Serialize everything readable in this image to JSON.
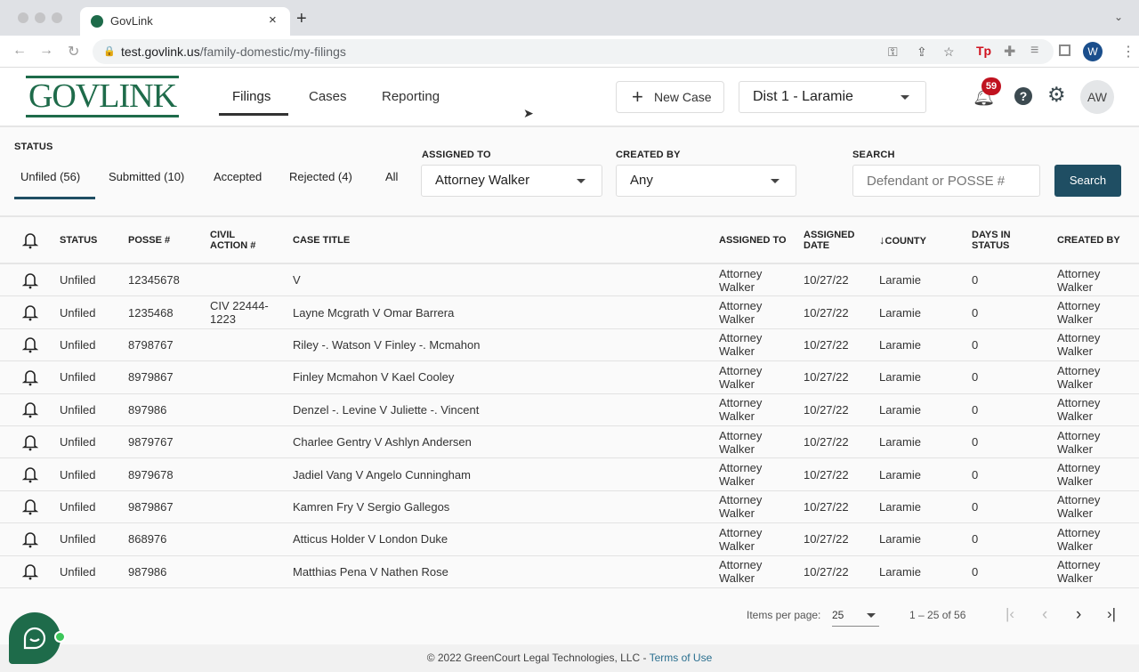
{
  "browser": {
    "tab_title": "GovLink",
    "url_host": "test.govlink.us",
    "url_path": "/family-domestic/my-filings",
    "profile_initial": "W",
    "ext_label": "Tp"
  },
  "header": {
    "logo": "GOVLINK",
    "nav": [
      {
        "label": "Filings",
        "active": true
      },
      {
        "label": "Cases"
      },
      {
        "label": "Reporting"
      }
    ],
    "new_case": "New Case",
    "district": "Dist 1 - Laramie",
    "notif_count": "59",
    "avatar": "AW"
  },
  "filters": {
    "status_label": "STATUS",
    "tabs": [
      "Unfiled (56)",
      "Submitted (10)",
      "Accepted",
      "Rejected (4)",
      "All"
    ],
    "active_tab": 0,
    "assigned_label": "ASSIGNED TO",
    "assigned_value": "Attorney Walker",
    "created_label": "CREATED BY",
    "created_value": "Any",
    "search_label": "SEARCH",
    "search_placeholder": "Defendant or POSSE #",
    "search_button": "Search"
  },
  "table": {
    "headers": [
      "STATUS",
      "POSSE #",
      "CIVIL ACTION #",
      "CASE TITLE",
      "ASSIGNED TO",
      "ASSIGNED DATE",
      "COUNTY",
      "DAYS IN STATUS",
      "CREATED BY"
    ],
    "sort_column": "COUNTY",
    "sort_direction": "desc",
    "rows": [
      [
        "Unfiled",
        "12345678",
        "",
        "V",
        "Attorney Walker",
        "10/27/22",
        "Laramie",
        "0",
        "Attorney Walker"
      ],
      [
        "Unfiled",
        "1235468",
        "CIV 22444-1223",
        "Layne Mcgrath V Omar Barrera",
        "Attorney Walker",
        "10/27/22",
        "Laramie",
        "0",
        "Attorney Walker"
      ],
      [
        "Unfiled",
        "8798767",
        "",
        "Riley -. Watson V Finley -. Mcmahon",
        "Attorney Walker",
        "10/27/22",
        "Laramie",
        "0",
        "Attorney Walker"
      ],
      [
        "Unfiled",
        "8979867",
        "",
        "Finley Mcmahon V Kael Cooley",
        "Attorney Walker",
        "10/27/22",
        "Laramie",
        "0",
        "Attorney Walker"
      ],
      [
        "Unfiled",
        "897986",
        "",
        "Denzel -. Levine V Juliette -. Vincent",
        "Attorney Walker",
        "10/27/22",
        "Laramie",
        "0",
        "Attorney Walker"
      ],
      [
        "Unfiled",
        "9879767",
        "",
        "Charlee Gentry V Ashlyn Andersen",
        "Attorney Walker",
        "10/27/22",
        "Laramie",
        "0",
        "Attorney Walker"
      ],
      [
        "Unfiled",
        "8979678",
        "",
        "Jadiel Vang V Angelo Cunningham",
        "Attorney Walker",
        "10/27/22",
        "Laramie",
        "0",
        "Attorney Walker"
      ],
      [
        "Unfiled",
        "9879867",
        "",
        "Kamren Fry V Sergio Gallegos",
        "Attorney Walker",
        "10/27/22",
        "Laramie",
        "0",
        "Attorney Walker"
      ],
      [
        "Unfiled",
        "868976",
        "",
        "Atticus Holder V London Duke",
        "Attorney Walker",
        "10/27/22",
        "Laramie",
        "0",
        "Attorney Walker"
      ],
      [
        "Unfiled",
        "987986",
        "",
        "Matthias Pena V Nathen Rose",
        "Attorney Walker",
        "10/27/22",
        "Laramie",
        "0",
        "Attorney Walker"
      ]
    ]
  },
  "pagination": {
    "items_label": "Items per page:",
    "per_page": "25",
    "range": "1 – 25 of 56"
  },
  "footer": {
    "copyright": "© 2022 GreenCourt Legal Technologies, LLC - ",
    "terms": "Terms of Use"
  },
  "colors": {
    "brand": "#1e6b4a",
    "primary_button": "#1f4e63",
    "badge": "#c0121f",
    "online": "#3cc65a"
  }
}
